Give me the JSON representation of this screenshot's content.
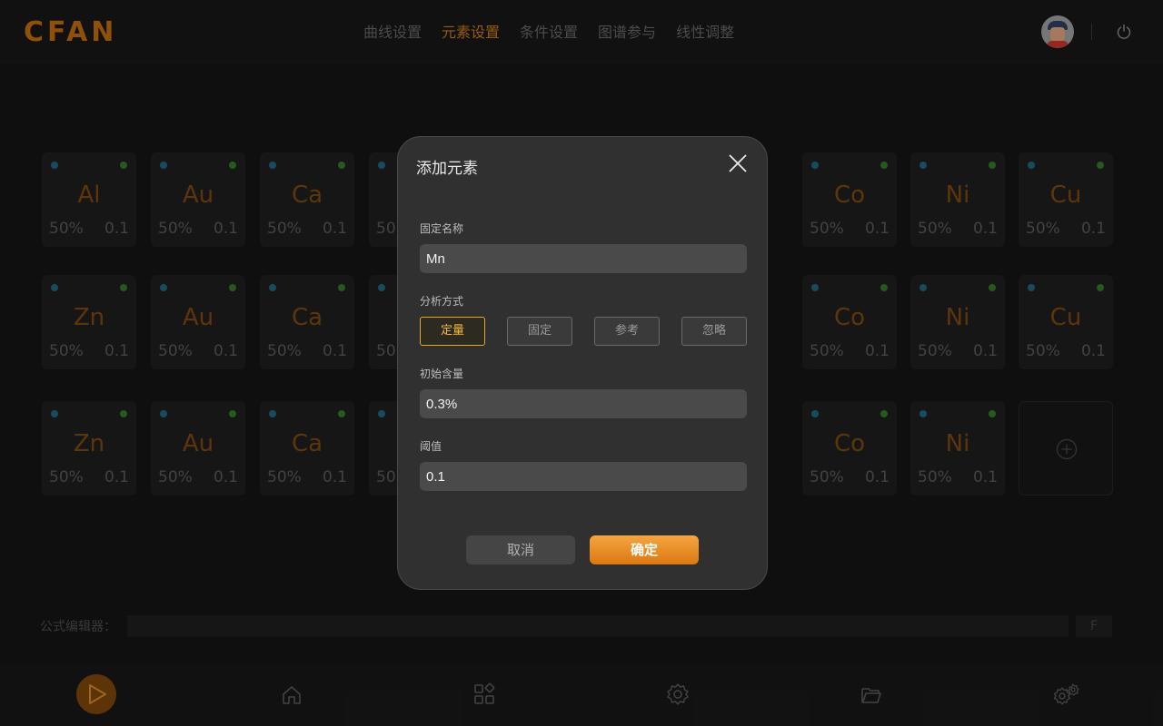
{
  "app": {
    "logo": "CFAN",
    "nav": [
      "曲线设置",
      "元素设置",
      "条件设置",
      "图谱参与",
      "线性调整"
    ],
    "active_nav": 1
  },
  "elements": [
    [
      {
        "symbol": "Al",
        "percent": "50%",
        "threshold": "0.1"
      },
      {
        "symbol": "Au",
        "percent": "50%",
        "threshold": "0.1"
      },
      {
        "symbol": "Ca",
        "percent": "50%",
        "threshold": "0.1"
      },
      {
        "symbol": "",
        "percent": "50",
        "threshold": ""
      },
      {
        "symbol": "",
        "percent": "",
        "threshold": ""
      },
      {
        "symbol": "",
        "percent": "",
        "threshold": ".1"
      },
      {
        "symbol": "Co",
        "percent": "50%",
        "threshold": "0.1"
      },
      {
        "symbol": "Ni",
        "percent": "50%",
        "threshold": "0.1"
      },
      {
        "symbol": "Cu",
        "percent": "50%",
        "threshold": "0.1"
      }
    ],
    [
      {
        "symbol": "Zn",
        "percent": "50%",
        "threshold": "0.1"
      },
      {
        "symbol": "Au",
        "percent": "50%",
        "threshold": "0.1"
      },
      {
        "symbol": "Ca",
        "percent": "50%",
        "threshold": "0.1"
      },
      {
        "symbol": "",
        "percent": "50",
        "threshold": ""
      },
      {
        "symbol": "",
        "percent": "",
        "threshold": ""
      },
      {
        "symbol": "",
        "percent": "",
        "threshold": ".1"
      },
      {
        "symbol": "Co",
        "percent": "50%",
        "threshold": "0.1"
      },
      {
        "symbol": "Ni",
        "percent": "50%",
        "threshold": "0.1"
      },
      {
        "symbol": "Cu",
        "percent": "50%",
        "threshold": "0.1"
      }
    ],
    [
      {
        "symbol": "Zn",
        "percent": "50%",
        "threshold": "0.1"
      },
      {
        "symbol": "Au",
        "percent": "50%",
        "threshold": "0.1"
      },
      {
        "symbol": "Ca",
        "percent": "50%",
        "threshold": "0.1"
      },
      {
        "symbol": "",
        "percent": "50",
        "threshold": ""
      },
      {
        "symbol": "",
        "percent": "",
        "threshold": ""
      },
      {
        "symbol": "",
        "percent": "",
        "threshold": ".1"
      },
      {
        "symbol": "Co",
        "percent": "50%",
        "threshold": "0.1"
      },
      {
        "symbol": "Ni",
        "percent": "50%",
        "threshold": "0.1"
      },
      {
        "add": true
      }
    ]
  ],
  "formula": {
    "label": "公式编辑器：",
    "button": "F"
  },
  "bottom_icons": [
    "play-icon",
    "home-icon",
    "apps-icon",
    "settings-icon",
    "folder-icon",
    "advanced-settings-icon"
  ],
  "modal": {
    "title": "添加元素",
    "name_label": "固定名称",
    "name_value": "Mn",
    "mode_label": "分析方式",
    "modes": [
      "定量",
      "固定",
      "参考",
      "忽略"
    ],
    "active_mode": 0,
    "initial_label": "初始含量",
    "initial_value": "0.3%",
    "threshold_label": "阈值",
    "threshold_value": "0.1",
    "cancel": "取消",
    "confirm": "确定"
  },
  "colors": {
    "accent": "#e8a81c",
    "confirm_gradient": [
      "#f5a540",
      "#dc7812"
    ],
    "background": "#121212",
    "modal_bg": "#303030"
  }
}
